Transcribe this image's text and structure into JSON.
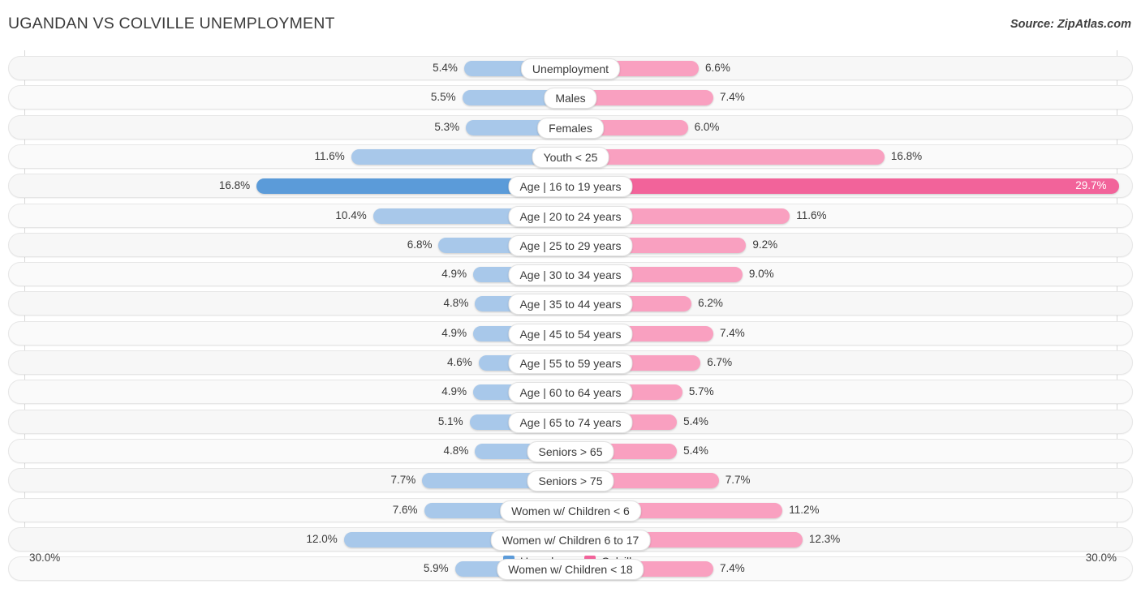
{
  "header": {
    "title": "UGANDAN VS COLVILLE UNEMPLOYMENT",
    "source": "Source: ZipAtlas.com"
  },
  "axis": {
    "left_label": "30.0%",
    "right_label": "30.0%"
  },
  "legend": {
    "items": [
      {
        "label": "Ugandan",
        "color": "#5b9bd9"
      },
      {
        "label": "Colville",
        "color": "#f2639a"
      }
    ]
  },
  "colors": {
    "left_normal": "#a8c8ea",
    "left_strong": "#5b9bd9",
    "right_normal": "#f9a0c0",
    "right_strong": "#f2639a",
    "track": "#f7f7f7"
  },
  "chart_data": {
    "type": "bar",
    "title": "UGANDAN VS COLVILLE UNEMPLOYMENT",
    "subtitle": "",
    "orientation": "horizontal-diverging",
    "xlabel": "",
    "ylabel": "",
    "xlim": [
      0,
      30
    ],
    "axis_max": 30.0,
    "grid": true,
    "legend_position": "bottom-center",
    "categories": [
      "Unemployment",
      "Males",
      "Females",
      "Youth < 25",
      "Age | 16 to 19 years",
      "Age | 20 to 24 years",
      "Age | 25 to 29 years",
      "Age | 30 to 34 years",
      "Age | 35 to 44 years",
      "Age | 45 to 54 years",
      "Age | 55 to 59 years",
      "Age | 60 to 64 years",
      "Age | 65 to 74 years",
      "Seniors > 65",
      "Seniors > 75",
      "Women w/ Children < 6",
      "Women w/ Children 6 to 17",
      "Women w/ Children < 18"
    ],
    "series": [
      {
        "name": "Ugandan",
        "color": "#5b9bd9",
        "values": [
          5.4,
          5.5,
          5.3,
          11.6,
          16.8,
          10.4,
          6.8,
          4.9,
          4.8,
          4.9,
          4.6,
          4.9,
          5.1,
          4.8,
          7.7,
          7.6,
          12.0,
          5.9
        ],
        "labels": [
          "5.4%",
          "5.5%",
          "5.3%",
          "11.6%",
          "16.8%",
          "10.4%",
          "6.8%",
          "4.9%",
          "4.8%",
          "4.9%",
          "4.6%",
          "4.9%",
          "5.1%",
          "4.8%",
          "7.7%",
          "7.6%",
          "12.0%",
          "5.9%"
        ]
      },
      {
        "name": "Colville",
        "color": "#f2639a",
        "values": [
          6.6,
          7.4,
          6.0,
          16.8,
          29.7,
          11.6,
          9.2,
          9.0,
          6.2,
          7.4,
          6.7,
          5.7,
          5.4,
          5.4,
          7.7,
          11.2,
          12.3,
          7.4
        ],
        "labels": [
          "6.6%",
          "7.4%",
          "6.0%",
          "16.8%",
          "29.7%",
          "11.6%",
          "9.2%",
          "9.0%",
          "6.2%",
          "7.4%",
          "6.7%",
          "5.7%",
          "5.4%",
          "5.4%",
          "7.7%",
          "11.2%",
          "12.3%",
          "7.4%"
        ]
      }
    ],
    "rows": [
      {
        "label": "Unemployment",
        "left": 5.4,
        "left_label": "5.4%",
        "right": 6.6,
        "right_label": "6.6%"
      },
      {
        "label": "Males",
        "left": 5.5,
        "left_label": "5.5%",
        "right": 7.4,
        "right_label": "7.4%"
      },
      {
        "label": "Females",
        "left": 5.3,
        "left_label": "5.3%",
        "right": 6.0,
        "right_label": "6.0%"
      },
      {
        "label": "Youth < 25",
        "left": 11.6,
        "left_label": "11.6%",
        "right": 16.8,
        "right_label": "16.8%"
      },
      {
        "label": "Age | 16 to 19 years",
        "left": 16.8,
        "left_label": "16.8%",
        "right": 29.7,
        "right_label": "29.7%"
      },
      {
        "label": "Age | 20 to 24 years",
        "left": 10.4,
        "left_label": "10.4%",
        "right": 11.6,
        "right_label": "11.6%"
      },
      {
        "label": "Age | 25 to 29 years",
        "left": 6.8,
        "left_label": "6.8%",
        "right": 9.2,
        "right_label": "9.2%"
      },
      {
        "label": "Age | 30 to 34 years",
        "left": 4.9,
        "left_label": "4.9%",
        "right": 9.0,
        "right_label": "9.0%"
      },
      {
        "label": "Age | 35 to 44 years",
        "left": 4.8,
        "left_label": "4.8%",
        "right": 6.2,
        "right_label": "6.2%"
      },
      {
        "label": "Age | 45 to 54 years",
        "left": 4.9,
        "left_label": "4.9%",
        "right": 7.4,
        "right_label": "7.4%"
      },
      {
        "label": "Age | 55 to 59 years",
        "left": 4.6,
        "left_label": "4.6%",
        "right": 6.7,
        "right_label": "6.7%"
      },
      {
        "label": "Age | 60 to 64 years",
        "left": 4.9,
        "left_label": "4.9%",
        "right": 5.7,
        "right_label": "5.7%"
      },
      {
        "label": "Age | 65 to 74 years",
        "left": 5.1,
        "left_label": "5.1%",
        "right": 5.4,
        "right_label": "5.4%"
      },
      {
        "label": "Seniors > 65",
        "left": 4.8,
        "left_label": "4.8%",
        "right": 5.4,
        "right_label": "5.4%"
      },
      {
        "label": "Seniors > 75",
        "left": 7.7,
        "left_label": "7.7%",
        "right": 7.7,
        "right_label": "7.7%"
      },
      {
        "label": "Women w/ Children < 6",
        "left": 7.6,
        "left_label": "7.6%",
        "right": 11.2,
        "right_label": "11.2%"
      },
      {
        "label": "Women w/ Children 6 to 17",
        "left": 12.0,
        "left_label": "12.0%",
        "right": 12.3,
        "right_label": "12.3%"
      },
      {
        "label": "Women w/ Children < 18",
        "left": 5.9,
        "left_label": "5.9%",
        "right": 7.4,
        "right_label": "7.4%"
      }
    ]
  }
}
